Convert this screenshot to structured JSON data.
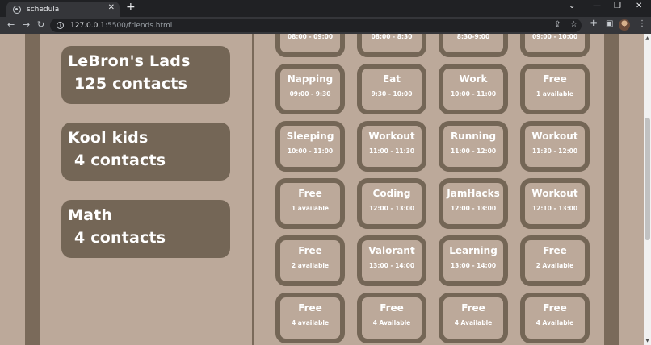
{
  "browser": {
    "tab_title": "schedula",
    "tab_close": "✕",
    "new_tab": "+",
    "url_host": "127.0.0.1",
    "url_path": ":5500/friends.html",
    "minimize": "—",
    "restore": "❐",
    "close": "✕",
    "tab_search": "⌄"
  },
  "groups": [
    {
      "name": "LeBron's Lads",
      "count": "125 contacts"
    },
    {
      "name": "Kool kids",
      "count": "4 contacts"
    },
    {
      "name": "Math",
      "count": "4 contacts"
    }
  ],
  "top_times": [
    "08:00 - 09:00",
    "08:00 - 8:30",
    "8:30-9:00",
    "09:00 - 10:00"
  ],
  "schedule": [
    [
      {
        "title": "Napping",
        "time": "09:00 - 9:30"
      },
      {
        "title": "Eat",
        "time": "9:30 - 10:00"
      },
      {
        "title": "Work",
        "time": "10:00 - 11:00"
      },
      {
        "title": "Free",
        "time": "1 available"
      }
    ],
    [
      {
        "title": "Sleeping",
        "time": "10:00 - 11:00"
      },
      {
        "title": "Workout",
        "time": "11:00 - 11:30"
      },
      {
        "title": "Running",
        "time": "11:00 - 12:00"
      },
      {
        "title": "Workout",
        "time": "11:30 - 12:00"
      }
    ],
    [
      {
        "title": "Free",
        "time": "1 available"
      },
      {
        "title": "Coding",
        "time": "12:00 - 13:00"
      },
      {
        "title": "JamHacks",
        "time": "12:00 - 13:00"
      },
      {
        "title": "Workout",
        "time": "12:10 - 13:00"
      }
    ],
    [
      {
        "title": "Free",
        "time": "2 available"
      },
      {
        "title": "Valorant",
        "time": "13:00 - 14:00"
      },
      {
        "title": "Learning",
        "time": "13:00 - 14:00"
      },
      {
        "title": "Free",
        "time": "2 Available"
      }
    ],
    [
      {
        "title": "Free",
        "time": "4 available"
      },
      {
        "title": "Free",
        "time": "4 Available"
      },
      {
        "title": "Free",
        "time": "4 Available"
      },
      {
        "title": "Free",
        "time": "4 Available"
      }
    ]
  ],
  "colors": {
    "page_bg": "#bca99a",
    "band": "#7a6a5a",
    "card": "#746656",
    "text": "#ffffff"
  }
}
